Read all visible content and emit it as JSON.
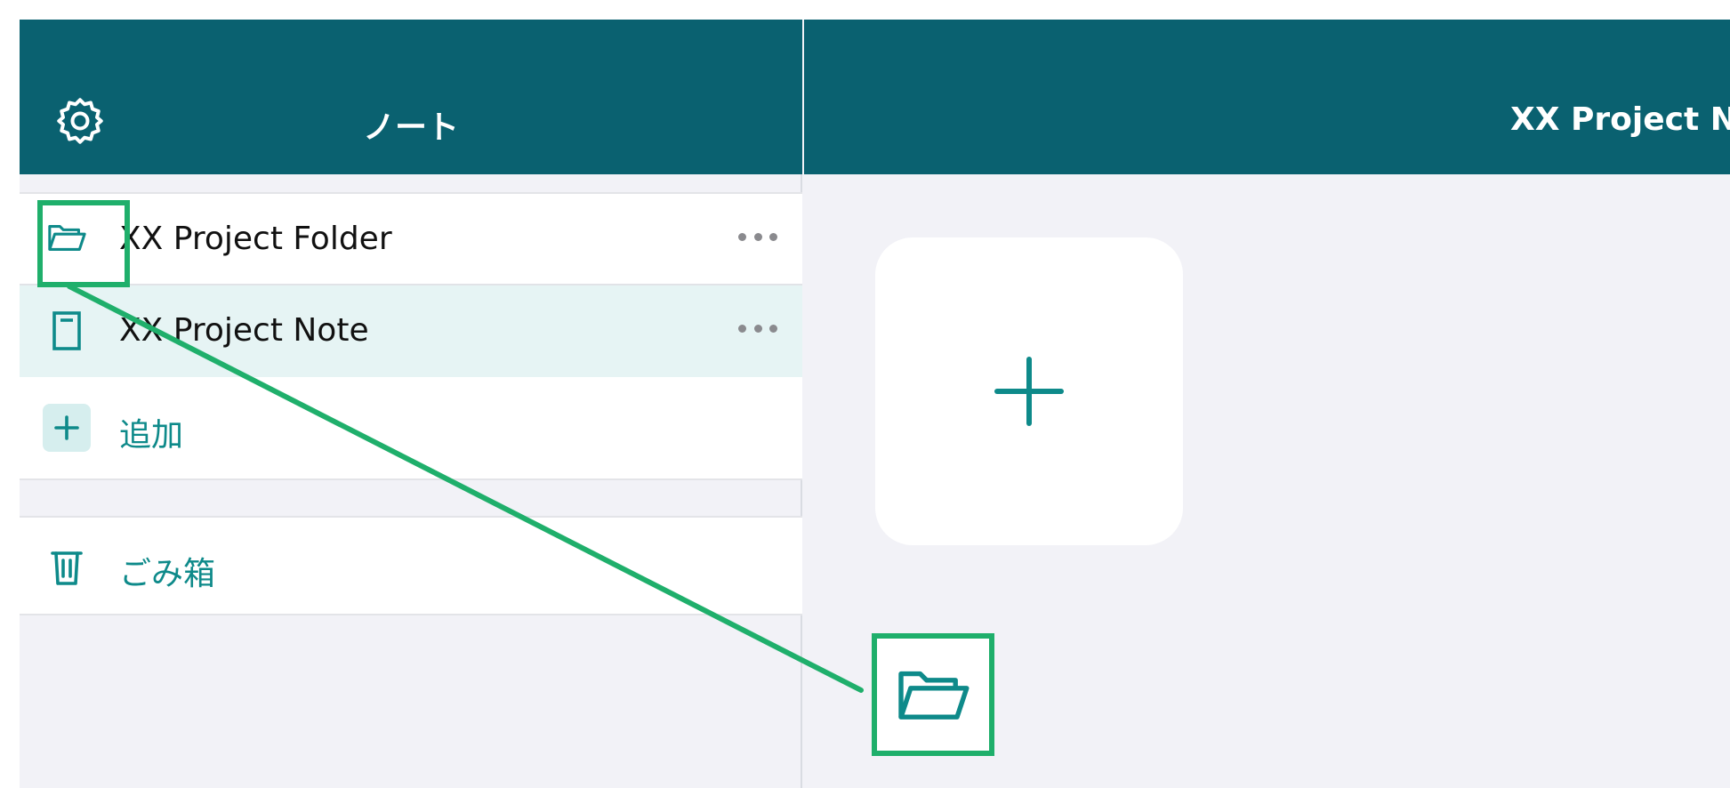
{
  "sidebar": {
    "title": "ノート",
    "settings_icon": "gear-icon",
    "items": [
      {
        "label": "XX Project Folder",
        "icon": "folder-open-icon",
        "more_icon": "ellipsis-icon"
      },
      {
        "label": "XX Project Note",
        "icon": "notebook-icon",
        "more_icon": "ellipsis-icon",
        "selected": true
      },
      {
        "label": "追加",
        "icon": "plus-icon"
      }
    ],
    "trash": {
      "label": "ごみ箱",
      "icon": "trash-icon"
    }
  },
  "main": {
    "title": "XX Project N",
    "add_card_icon": "plus-icon",
    "callout_icon": "folder-open-icon"
  },
  "colors": {
    "header": "#0a6170",
    "accent": "#0e8a8a",
    "selected_row": "#e6f4f4",
    "annotation": "#1faf6b",
    "background": "#f2f2f7"
  }
}
